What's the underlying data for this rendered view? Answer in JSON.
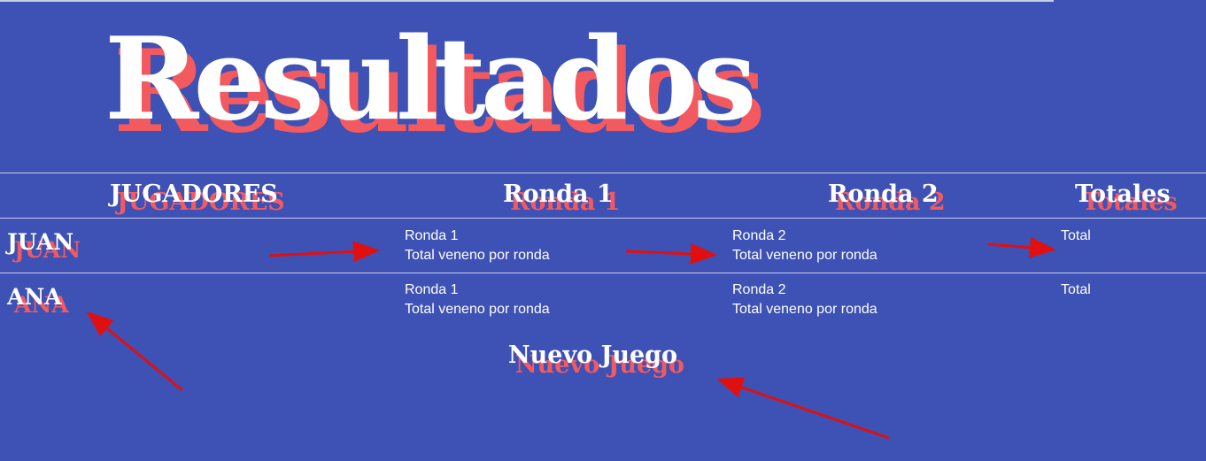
{
  "header": {
    "title": "Resultados"
  },
  "table": {
    "columns": [
      "JUGADORES",
      "Ronda 1",
      "Ronda 2",
      "Totales"
    ],
    "rows": [
      {
        "player": "JUAN",
        "ronda1": [
          "Ronda 1",
          "Total veneno por ronda"
        ],
        "ronda2": [
          "Ronda 2",
          "Total veneno por ronda"
        ],
        "total": "Total"
      },
      {
        "player": "ANA",
        "ronda1": [
          "Ronda 1",
          "Total veneno por ronda"
        ],
        "ronda2": [
          "Ronda 2",
          "Total veneno por ronda"
        ],
        "total": "Total"
      }
    ]
  },
  "actions": {
    "new_game_label": "Nuevo Juego"
  },
  "colors": {
    "background": "#3e51b5",
    "shadow": "#f35a60",
    "text": "#ffffff",
    "annotation_arrow": "#e01010"
  }
}
